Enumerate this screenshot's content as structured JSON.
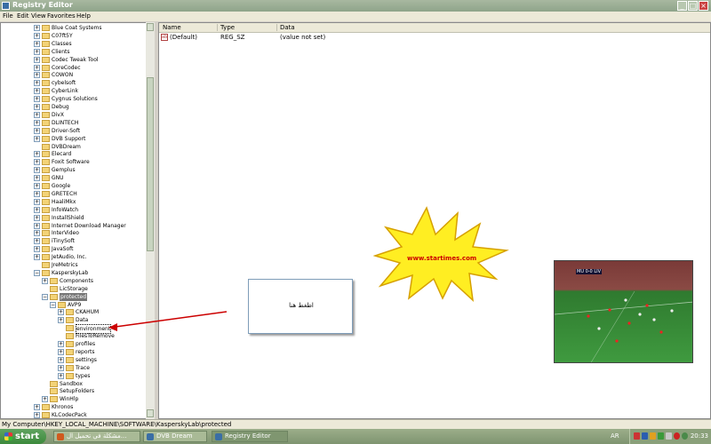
{
  "window": {
    "title": "Registry Editor"
  },
  "menu": [
    "File",
    "Edit",
    "View",
    "Favorites",
    "Help"
  ],
  "tree": {
    "items": [
      {
        "label": "Blue Coat Systems",
        "depth": 0,
        "expander": "+"
      },
      {
        "label": "C07ft5Y",
        "depth": 0,
        "expander": "+"
      },
      {
        "label": "Classes",
        "depth": 0,
        "expander": "+"
      },
      {
        "label": "Clients",
        "depth": 0,
        "expander": "+"
      },
      {
        "label": "Codec Tweak Tool",
        "depth": 0,
        "expander": "+"
      },
      {
        "label": "CoreCodec",
        "depth": 0,
        "expander": "+"
      },
      {
        "label": "COWON",
        "depth": 0,
        "expander": "+"
      },
      {
        "label": "cybelsoft",
        "depth": 0,
        "expander": "+"
      },
      {
        "label": "CyberLink",
        "depth": 0,
        "expander": "+"
      },
      {
        "label": "Cygnus Solutions",
        "depth": 0,
        "expander": "+"
      },
      {
        "label": "Debug",
        "depth": 0,
        "expander": "+"
      },
      {
        "label": "DivX",
        "depth": 0,
        "expander": "+"
      },
      {
        "label": "DLINTECH",
        "depth": 0,
        "expander": "+"
      },
      {
        "label": "Driver-Soft",
        "depth": 0,
        "expander": "+"
      },
      {
        "label": "DVB Support",
        "depth": 0,
        "expander": "+"
      },
      {
        "label": "DVBDream",
        "depth": 0,
        "expander": ""
      },
      {
        "label": "Elecard",
        "depth": 0,
        "expander": "+"
      },
      {
        "label": "Foxit Software",
        "depth": 0,
        "expander": "+"
      },
      {
        "label": "Gemplus",
        "depth": 0,
        "expander": "+"
      },
      {
        "label": "GNU",
        "depth": 0,
        "expander": "+"
      },
      {
        "label": "Google",
        "depth": 0,
        "expander": "+"
      },
      {
        "label": "GRETECH",
        "depth": 0,
        "expander": "+"
      },
      {
        "label": "HaaliMkx",
        "depth": 0,
        "expander": "+"
      },
      {
        "label": "InfoWatch",
        "depth": 0,
        "expander": "+"
      },
      {
        "label": "InstallShield",
        "depth": 0,
        "expander": "+"
      },
      {
        "label": "Internet Download Manager",
        "depth": 0,
        "expander": "+"
      },
      {
        "label": "InterVideo",
        "depth": 0,
        "expander": "+"
      },
      {
        "label": "iTinySoft",
        "depth": 0,
        "expander": "+"
      },
      {
        "label": "JavaSoft",
        "depth": 0,
        "expander": "+"
      },
      {
        "label": "JetAudio, Inc.",
        "depth": 0,
        "expander": "+"
      },
      {
        "label": "JreMetrics",
        "depth": 0,
        "expander": ""
      },
      {
        "label": "KasperskyLab",
        "depth": 0,
        "expander": "-"
      },
      {
        "label": "Components",
        "depth": 1,
        "expander": "+"
      },
      {
        "label": "LicStorage",
        "depth": 1,
        "expander": ""
      },
      {
        "label": "protected",
        "depth": 1,
        "expander": "-",
        "selected": true
      },
      {
        "label": "AVP9",
        "depth": 2,
        "expander": "-"
      },
      {
        "label": "CKAHUM",
        "depth": 3,
        "expander": "+"
      },
      {
        "label": "Data",
        "depth": 3,
        "expander": "+"
      },
      {
        "label": "environment",
        "depth": 3,
        "expander": "",
        "focused": true
      },
      {
        "label": "FilesToRemove",
        "depth": 3,
        "expander": ""
      },
      {
        "label": "profiles",
        "depth": 3,
        "expander": "+"
      },
      {
        "label": "reports",
        "depth": 3,
        "expander": "+"
      },
      {
        "label": "settings",
        "depth": 3,
        "expander": "+"
      },
      {
        "label": "Trace",
        "depth": 3,
        "expander": "+"
      },
      {
        "label": "types",
        "depth": 3,
        "expander": "+"
      },
      {
        "label": "Sandbox",
        "depth": 1,
        "expander": ""
      },
      {
        "label": "SetupFolders",
        "depth": 1,
        "expander": ""
      },
      {
        "label": "WinHlp",
        "depth": 1,
        "expander": "+"
      },
      {
        "label": "Khronos",
        "depth": 0,
        "expander": "+"
      },
      {
        "label": "KLCodecPack",
        "depth": 0,
        "expander": "+"
      }
    ]
  },
  "list": {
    "columns": [
      "Name",
      "Type",
      "Data"
    ],
    "rows": [
      {
        "name": "(Default)",
        "type": "REG_SZ",
        "data": "(value not set)",
        "icon": "ab"
      }
    ]
  },
  "status": {
    "path": "My Computer\\HKEY_LOCAL_MACHINE\\SOFTWARE\\KasperskyLab\\protected"
  },
  "overlay": {
    "note": "اظغط هنا",
    "starburst": "www.startimes.com",
    "scoreboard": "MU 0-0 LIV"
  },
  "taskbar": {
    "start": "start",
    "buttons": [
      {
        "label": "مشكلة في تحميل ال...",
        "active": false,
        "color": "#d05a1e"
      },
      {
        "label": "DVB Dream",
        "active": false,
        "color": "#3a6ea5"
      },
      {
        "label": "Registry Editor",
        "active": true,
        "color": "#3a6ea5"
      }
    ],
    "lang": "AR",
    "clock": "20:33"
  }
}
